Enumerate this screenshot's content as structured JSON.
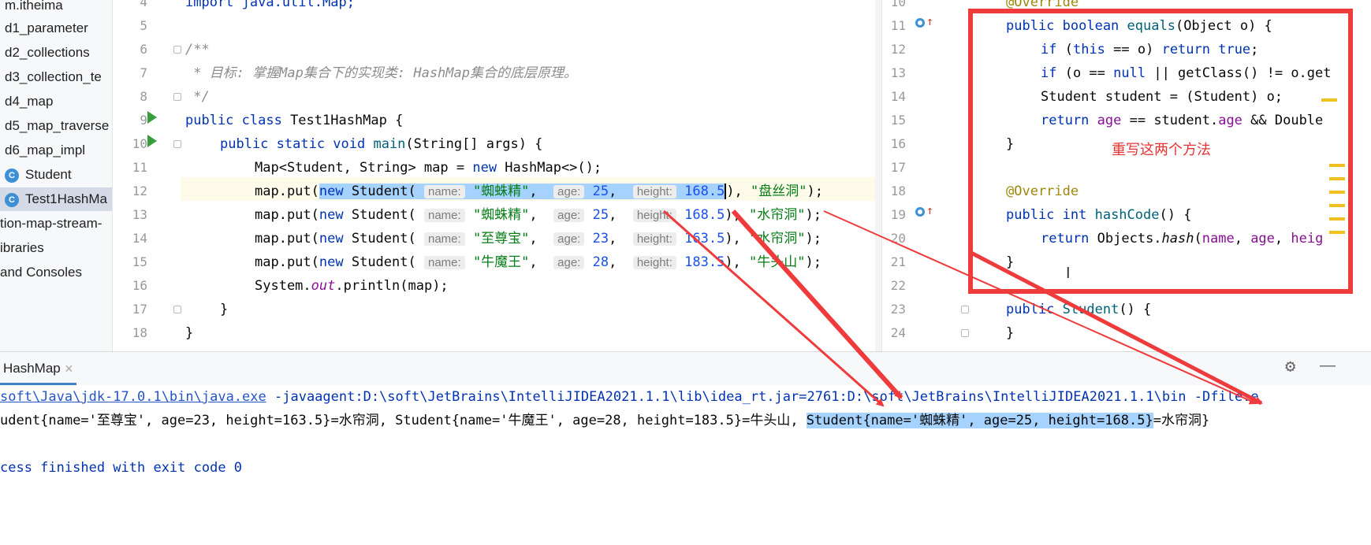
{
  "project_tree": {
    "items": [
      {
        "label": "m.itheima"
      },
      {
        "label": "d1_parameter"
      },
      {
        "label": "d2_collections"
      },
      {
        "label": "d3_collection_te"
      },
      {
        "label": "d4_map"
      },
      {
        "label": "d5_map_traverse"
      },
      {
        "label": "d6_map_impl"
      },
      {
        "label": "Student"
      },
      {
        "label": "Test1HashMa"
      },
      {
        "label": "tion-map-stream-"
      },
      {
        "label": "ibraries"
      },
      {
        "label": "and Consoles"
      }
    ]
  },
  "left_editor": {
    "line_numbers": [
      "4",
      "5",
      "6",
      "7",
      "8",
      "9",
      "10",
      "11",
      "12",
      "13",
      "14",
      "15",
      "16",
      "17",
      "18"
    ],
    "line4": "import java.util.Map;",
    "javadoc_open": "/**",
    "javadoc_body": " * 目标: 掌握Map集合下的实现类: HashMap集合的底层原理。",
    "javadoc_close": " */",
    "class_decl": {
      "kw": "public class ",
      "name": "Test1HashMap {"
    },
    "main_decl": {
      "kw": "public static void ",
      "method": "main",
      "rest": "(String[] args) {"
    },
    "map_decl": {
      "pre": "Map<Student, String> map = ",
      "kw": "new ",
      "post": "HashMap<>();"
    },
    "puts": [
      {
        "pre": "map.put(",
        "kw": "new ",
        "cls": "Student(",
        "name_hint": "name:",
        "name": "\"蜘蛛精\"",
        "age_hint": "age:",
        "age": "25",
        "height_hint": "height:",
        "height": "168.5",
        "val": "\"盘丝洞\""
      },
      {
        "pre": "map.put(",
        "kw": "new ",
        "cls": "Student(",
        "name_hint": "name:",
        "name": "\"蜘蛛精\"",
        "age_hint": "age:",
        "age": "25",
        "height_hint": "height:",
        "height": "168.5",
        "val": "\"水帘洞\""
      },
      {
        "pre": "map.put(",
        "kw": "new ",
        "cls": "Student(",
        "name_hint": "name:",
        "name": "\"至尊宝\"",
        "age_hint": "age:",
        "age": "23",
        "height_hint": "height:",
        "height": "163.5",
        "val": "\"水帘洞\""
      },
      {
        "pre": "map.put(",
        "kw": "new ",
        "cls": "Student(",
        "name_hint": "name:",
        "name": "\"牛魔王\"",
        "age_hint": "age:",
        "age": "28",
        "height_hint": "height:",
        "height": "183.5",
        "val": "\"牛头山\""
      }
    ],
    "comma": ",",
    "close_put": "), ",
    "end_put": ");",
    "println": {
      "pre": "System.",
      "field": "out",
      "post": ".println(map);"
    },
    "brace": "}"
  },
  "right_editor": {
    "line_numbers": [
      "10",
      "11",
      "12",
      "13",
      "14",
      "15",
      "16",
      "17",
      "18",
      "19",
      "20",
      "21",
      "22",
      "23",
      "24"
    ],
    "ann_override": "@Override",
    "equals_decl": {
      "kw": "public boolean ",
      "name": "equals",
      "rest": "(Object o) {"
    },
    "if_this": {
      "kw1": "if ",
      "p1": "(",
      "kw2": "this",
      "p2": " == o) ",
      "kw3": "return true",
      "p3": ";"
    },
    "if_null": {
      "kw1": "if ",
      "p1": "(o == ",
      "kw2": "null",
      "p2": " || getClass() != o.get"
    },
    "cast_line": "Student student = (Student) o;",
    "return_line": {
      "kw": "return ",
      "f1": "age",
      "mid": " == student.",
      "f2": "age",
      "post": " && Double"
    },
    "close": "}",
    "hash_decl": {
      "kw": "public int ",
      "name": "hashCode",
      "rest": "() {"
    },
    "hash_return": {
      "kw": "return ",
      "pre": "Objects.",
      "method": "hash",
      "p": "(",
      "f1": "name",
      "c1": ", ",
      "f2": "age",
      "c2": ", ",
      "f3": "heig"
    },
    "ctor": {
      "kw": "public ",
      "name": "Student",
      "rest": "() {"
    }
  },
  "annotation": {
    "note": "重写这两个方法",
    "cursor_glyph": "I",
    "box_color": "#ef3b3b",
    "arrow_color": "#ef3b3b"
  },
  "console": {
    "tab_label": "HashMap",
    "close_glyph": "✕",
    "settings_icon": "⚙",
    "minimize_icon": "—",
    "cmd_link": "soft\\Java\\jdk-17.0.1\\bin\\java.exe",
    "cmd_rest": " -javaagent:D:\\soft\\JetBrains\\IntelliJIDEA2021.1.1\\lib\\idea_rt.jar=2761:D:\\soft\\JetBrains\\IntelliJIDEA2021.1.1\\bin -Dfile.e",
    "output_pre": "udent{name='至尊宝', age=23, height=163.5}=水帘洞, Student{name='牛魔王', age=28, height=183.5}=牛头山, ",
    "output_sel": "Student{name='蜘蛛精', age=25, height=168.5}",
    "output_post": "=水帘洞}",
    "exit_line": "cess finished with exit code 0"
  }
}
